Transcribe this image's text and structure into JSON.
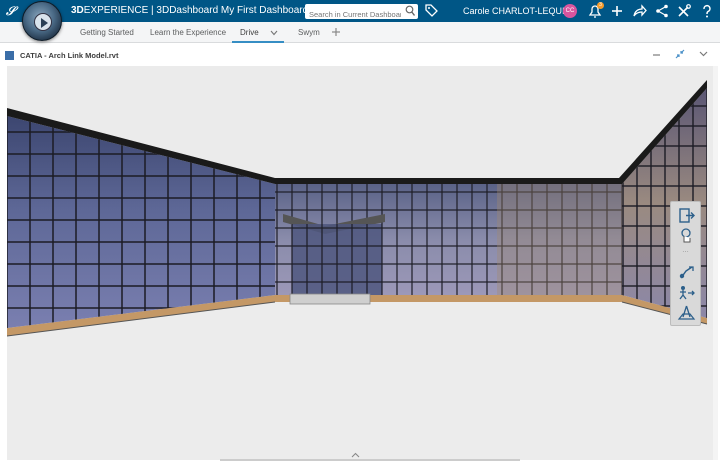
{
  "header": {
    "brand_bold": "3D",
    "brand_rest": "EXPERIENCE",
    "separator": " | ",
    "app": "3DDashboard",
    "dashboard": "My First Dashboard",
    "search_placeholder": "Search in Current Dashboard",
    "user_name": "Carole CHARLOT-LEQUIN",
    "avatar_initials": "CC",
    "notification_count": "3"
  },
  "tabs": [
    {
      "label": "Getting Started"
    },
    {
      "label": "Learn the Experience"
    },
    {
      "label": "Drive"
    },
    {
      "label": "Swym"
    }
  ],
  "widget": {
    "title": "CATIA - Arch Link Model.rvt"
  },
  "colors": {
    "topbar": "#005686",
    "active_tab_underline": "#368ec4",
    "avatar": "#d8559e",
    "badge": "#f39b2c"
  },
  "icons": {
    "compass": "compass-icon",
    "search": "search-icon",
    "tag": "tag-icon",
    "notifications": "bell-icon",
    "add": "plus-icon",
    "share": "share-icon",
    "network": "network-icon",
    "tools": "tools-icon",
    "help": "help-icon"
  }
}
